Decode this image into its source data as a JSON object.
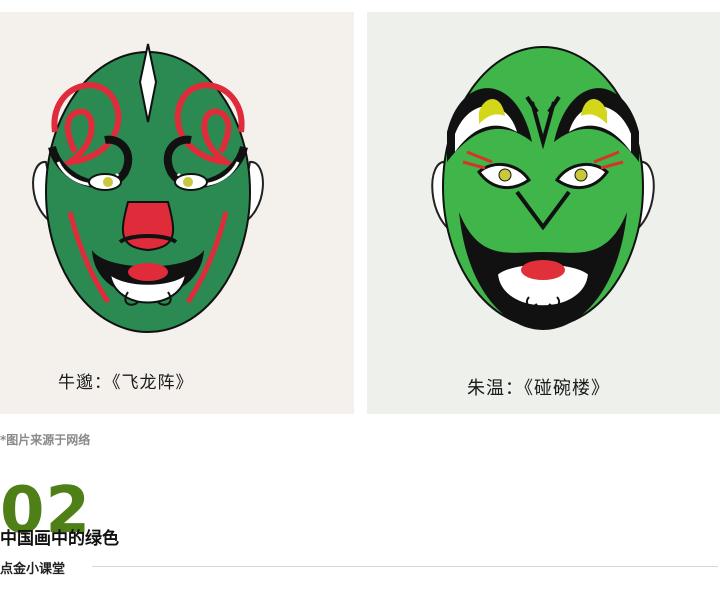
{
  "images": [
    {
      "caption": "牛邈：《飞龙阵》",
      "colors": {
        "background": "#f4f1ec",
        "face": "#2a8a52",
        "accent": "#e02b3a",
        "ink": "#111111"
      }
    },
    {
      "caption": "朱温：《碰碗楼》",
      "colors": {
        "background": "#eef0ec",
        "face": "#3fb54a",
        "accent": "#d4d61a",
        "ink": "#111111"
      }
    }
  ],
  "source_note": "*图片来源于网络",
  "section": {
    "number": "02",
    "title": "中国画中的绿色",
    "subtitle": "点金小课堂",
    "accent_color": "#4f7f17"
  }
}
